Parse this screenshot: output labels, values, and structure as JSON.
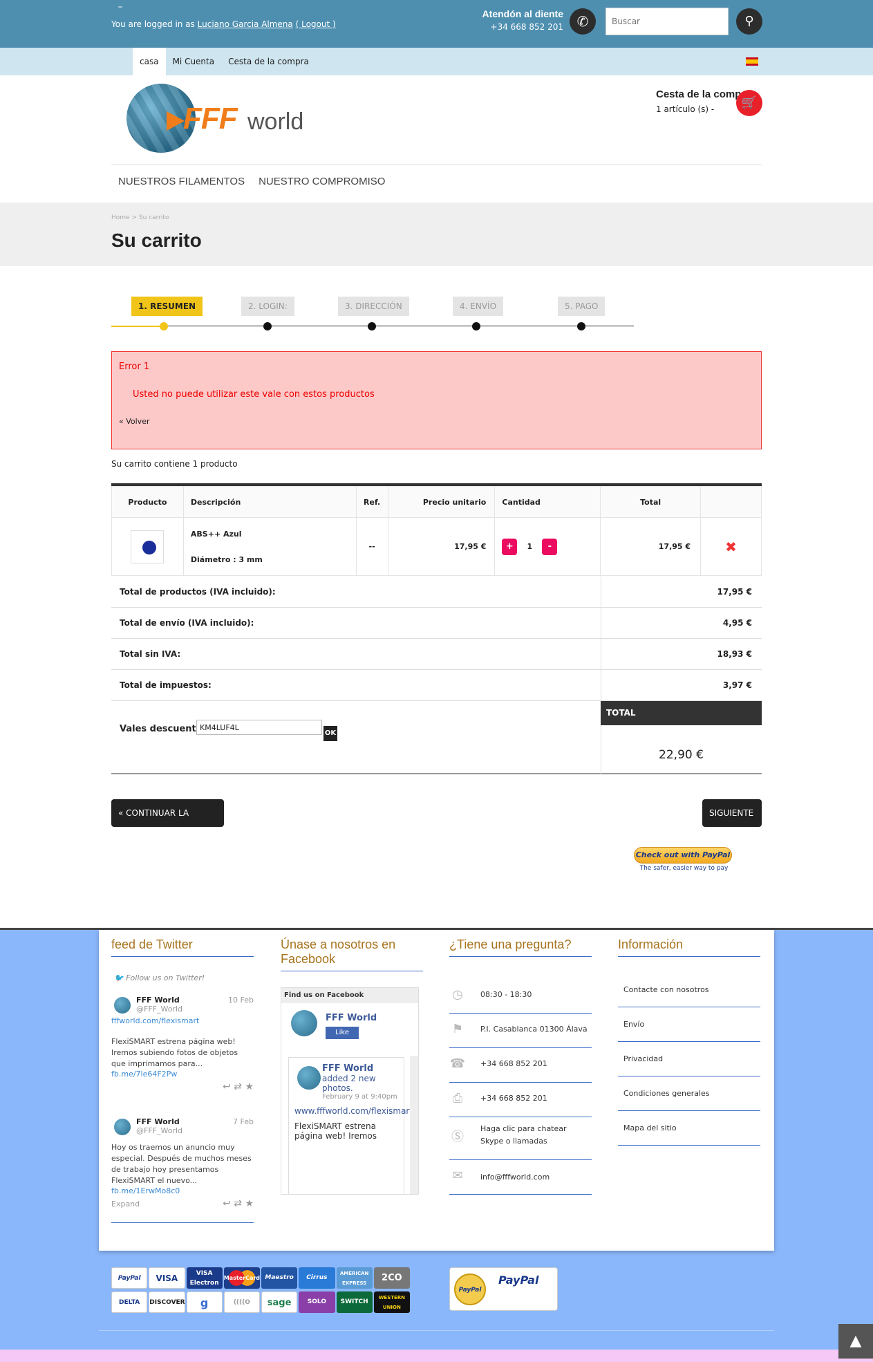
{
  "topbar": {
    "login_prefix": "You are logged in as",
    "user_name": "Luciano Garcia Almena",
    "logout": "( Logout )",
    "contact_title": "Atendón al diente",
    "contact_phone": "+34 668 852 201",
    "search_placeholder": "Buscar"
  },
  "subnav": {
    "items": [
      "casa",
      "Mi Cuenta",
      "Cesta de la compra"
    ]
  },
  "header": {
    "logo_fff": "FFF",
    "logo_world": "world",
    "cart_title": "Cesta de la compra",
    "cart_count": "1 artículo (s) -"
  },
  "mainnav": [
    "NUESTROS FILAMENTOS",
    "NUESTRO COMPROMISO"
  ],
  "breadcrumb": {
    "home": "Home",
    "sep": ">",
    "current": "Su carrito"
  },
  "page_title": "Su carrito",
  "steps": [
    "1. RESUMEN",
    "2. LOGIN:",
    "3. DIRECCIÓN",
    "4. ENVÍO",
    "5. PAGO"
  ],
  "error": {
    "title": "Error 1",
    "message": "Usted no puede utilizar este vale con estos productos",
    "back": "« Volver"
  },
  "cart_summary": "Su carrito contiene 1 producto",
  "table": {
    "headers": [
      "Producto",
      "Descripción",
      "Ref.",
      "Precio unitario",
      "Cantidad",
      "Total"
    ],
    "row": {
      "name": "ABS++ Azul",
      "attr": "Diámetro : 3 mm",
      "ref": "--",
      "unit_price": "17,95 €",
      "qty": "1",
      "total": "17,95 €"
    }
  },
  "totals": [
    {
      "label": "Total de productos (IVA incluido):",
      "value": "17,95 €"
    },
    {
      "label": "Total de envío (IVA incluido):",
      "value": "4,95 €"
    },
    {
      "label": "Total sin IVA:",
      "value": "18,93 €"
    },
    {
      "label": "Total de impuestos:",
      "value": "3,97 €"
    }
  ],
  "voucher": {
    "label": "Vales descuento",
    "value": "KM4LUF4L",
    "ok": "OK"
  },
  "grand_total": {
    "label": "TOTAL",
    "value": "22,90 €"
  },
  "buttons": {
    "continue": "« CONTINUAR LA COMPRA",
    "next": "SIGUIENTE »"
  },
  "paypal": {
    "checkout": "Check out with PayPal",
    "tagline": "The safer, easier way to pay"
  },
  "footer": {
    "twitter_title": "feed de Twitter",
    "twitter_follow": "Follow us on Twitter!",
    "tweets": [
      {
        "name": "FFF World",
        "handle": "@FFF_World",
        "date": "10 Feb",
        "link1": "fffworld.com/flexismart",
        "text": "FlexiSMART estrena página web! Iremos subiendo fotos de objetos que imprimamos para...",
        "link2": "fb.me/7le64F2Pw"
      },
      {
        "name": "FFF World",
        "handle": "@FFF_World",
        "date": "7 Feb",
        "text": "Hoy os traemos un anuncio muy especial. Después de muchos meses de trabajo hoy presentamos FlexiSMART el nuevo...",
        "link2": "fb.me/1ErwMo8c0",
        "expand": "Expand"
      }
    ],
    "facebook_title": "Únase a nosotros en Facebook",
    "fb": {
      "head": "Find us on Facebook",
      "page": "FFF World",
      "like": "Like",
      "post_name": "FFF World",
      "post_sub": "added 2 new photos.",
      "post_date": "February 9 at 9:40pm",
      "post_link": "www.fffworld.com/flexismart",
      "post_text": "FlexiSMART estrena página web! Iremos"
    },
    "question_title": "¿Tiene una pregunta?",
    "faq": [
      {
        "icon": "clock-icon",
        "text": "08:30 - 18:30"
      },
      {
        "icon": "signpost-icon",
        "text": "P.I. Casablanca 01300 Álava"
      },
      {
        "icon": "phone-icon",
        "text": "+34 668 852 201"
      },
      {
        "icon": "fax-icon",
        "text": "+34 668 852 201"
      },
      {
        "icon": "skype-icon",
        "text": "Haga clic para chatear Skype o llamadas"
      },
      {
        "icon": "mail-icon",
        "text": "info@fffworld.com"
      }
    ],
    "info_title": "Información",
    "info": [
      "Contacte con nosotros",
      "Envío",
      "Privacidad",
      "Condiciones generales",
      "Mapa del sitio"
    ],
    "payment_logos": [
      "PayPal",
      "VISA",
      "VISA Electron",
      "MasterCard",
      "Maestro",
      "Cirrus",
      "AMERICAN EXPRESS",
      "2CO",
      "DELTA",
      "DISCOVER",
      "g",
      "((((O",
      "sage",
      "SOLO",
      "SWITCH",
      "WESTERN UNION"
    ],
    "paypal_verified": {
      "seal": "PayPal",
      "title": "PayPal"
    }
  },
  "colors": {
    "topbar": "#4e8fb0",
    "subnav": "#cfe5ef",
    "accent_yellow": "#f0c419",
    "footer_bg": "#8ab7fb",
    "footer_title": "#a8731e",
    "error_bg": "#fcc8c8",
    "qty_button": "#ec0c5f"
  }
}
